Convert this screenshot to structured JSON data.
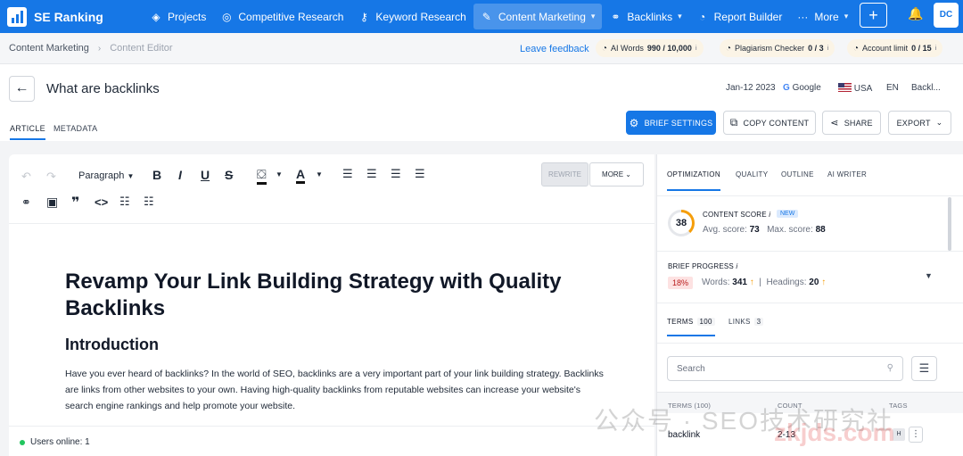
{
  "nav": {
    "brand": "SE Ranking",
    "items": [
      {
        "label": "Projects",
        "icon": "layers-icon"
      },
      {
        "label": "Competitive Research",
        "icon": "target-icon"
      },
      {
        "label": "Keyword Research",
        "icon": "key-icon"
      },
      {
        "label": "Content Marketing",
        "icon": "edit-icon"
      },
      {
        "label": "Backlinks",
        "icon": "link-icon"
      },
      {
        "label": "Report Builder",
        "icon": "chart-icon"
      },
      {
        "label": "More",
        "icon": "dots-icon"
      }
    ],
    "avatar": "DC",
    "colors": {
      "primary": "#1677e6"
    }
  },
  "breadcrumb": {
    "section": "Content Marketing",
    "page": "Content Editor",
    "feedback": "Leave feedback",
    "ai_words": "AI Words",
    "ai_words_value": "990 / 10,000",
    "plagiarism": "Plagiarism Checker",
    "plagiarism_value": "0 / 3",
    "account_limit": "Account limit",
    "account_limit_value": "0 / 15"
  },
  "header": {
    "title": "What are backlinks",
    "date": "Jan-12 2023",
    "engine": "Google",
    "country": "USA",
    "language": "EN",
    "keyword": "Backl...",
    "tabs": [
      "ARTICLE",
      "METADATA"
    ],
    "buttons": {
      "brief_settings": "BRIEF SETTINGS",
      "copy_content": "COPY CONTENT",
      "share": "SHARE",
      "export": "EXPORT"
    }
  },
  "editor": {
    "paragraph_style": "Paragraph",
    "rewrite": "REWRITE",
    "more": "MORE",
    "h1": "Revamp Your Link Building Strategy with Quality Backlinks",
    "h2": "Introduction",
    "paragraph": "Have you ever heard of backlinks? In the world of SEO, backlinks are a very important part of your link building strategy. Backlinks are links from other websites to your own. Having high-quality backlinks from reputable websites can increase your website's search engine rankings and help promote your website.",
    "users_online": "Users online: 1"
  },
  "side": {
    "tabs": [
      "OPTIMIZATION",
      "QUALITY",
      "OUTLINE",
      "AI WRITER"
    ],
    "content_score_label": "CONTENT SCORE",
    "content_score": "38",
    "content_score_fraction": 0.38,
    "new_badge": "NEW",
    "avg_label": "Avg. score:",
    "avg_value": "73",
    "max_label": "Max. score:",
    "max_value": "88",
    "brief_label": "BRIEF PROGRESS",
    "brief_pct": "18%",
    "words_label": "Words:",
    "words_value": "341",
    "headings_label": "Headings:",
    "headings_value": "20",
    "terms_tab": "TERMS",
    "terms_count": "100",
    "links_tab": "LINKS",
    "links_count": "3",
    "search_placeholder": "Search",
    "table_headers": [
      "TERMS (100)",
      "COUNT",
      "TAGS"
    ],
    "rows": [
      {
        "term": "backlink",
        "count": "2-13",
        "tag": "H"
      }
    ]
  },
  "watermark": {
    "text": "公众号 · SEO技术研究社",
    "text2": "zkjds.com"
  }
}
